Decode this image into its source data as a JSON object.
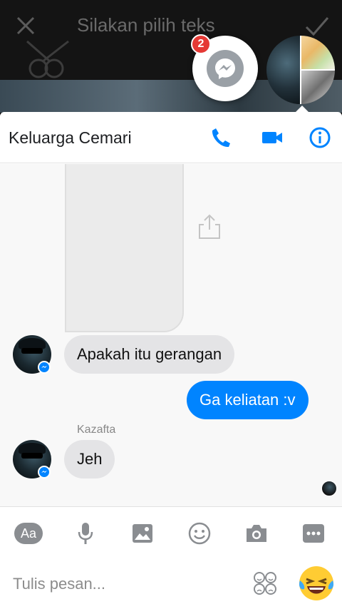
{
  "background": {
    "title": "Silakan pilih teks"
  },
  "chat_heads": {
    "unread_count": "2",
    "colors": {
      "badge": "#e53935"
    }
  },
  "header": {
    "title": "Keluarga Cemari",
    "icons": [
      "phone-icon",
      "video-call-icon",
      "info-icon"
    ],
    "accent": "#0084ff"
  },
  "messages": [
    {
      "direction": "incoming",
      "text": "Apakah itu gerangan"
    },
    {
      "direction": "outgoing",
      "text": "Ga keliatan :v"
    },
    {
      "direction": "incoming",
      "sender": "Kazafta",
      "text": "Jeh"
    }
  ],
  "toolbar": {
    "aa_label": "Aa",
    "items": [
      "text-style-button",
      "microphone-icon",
      "image-icon",
      "emoji-icon",
      "camera-icon",
      "more-icon"
    ]
  },
  "composer": {
    "placeholder": "Tulis pesan..."
  }
}
